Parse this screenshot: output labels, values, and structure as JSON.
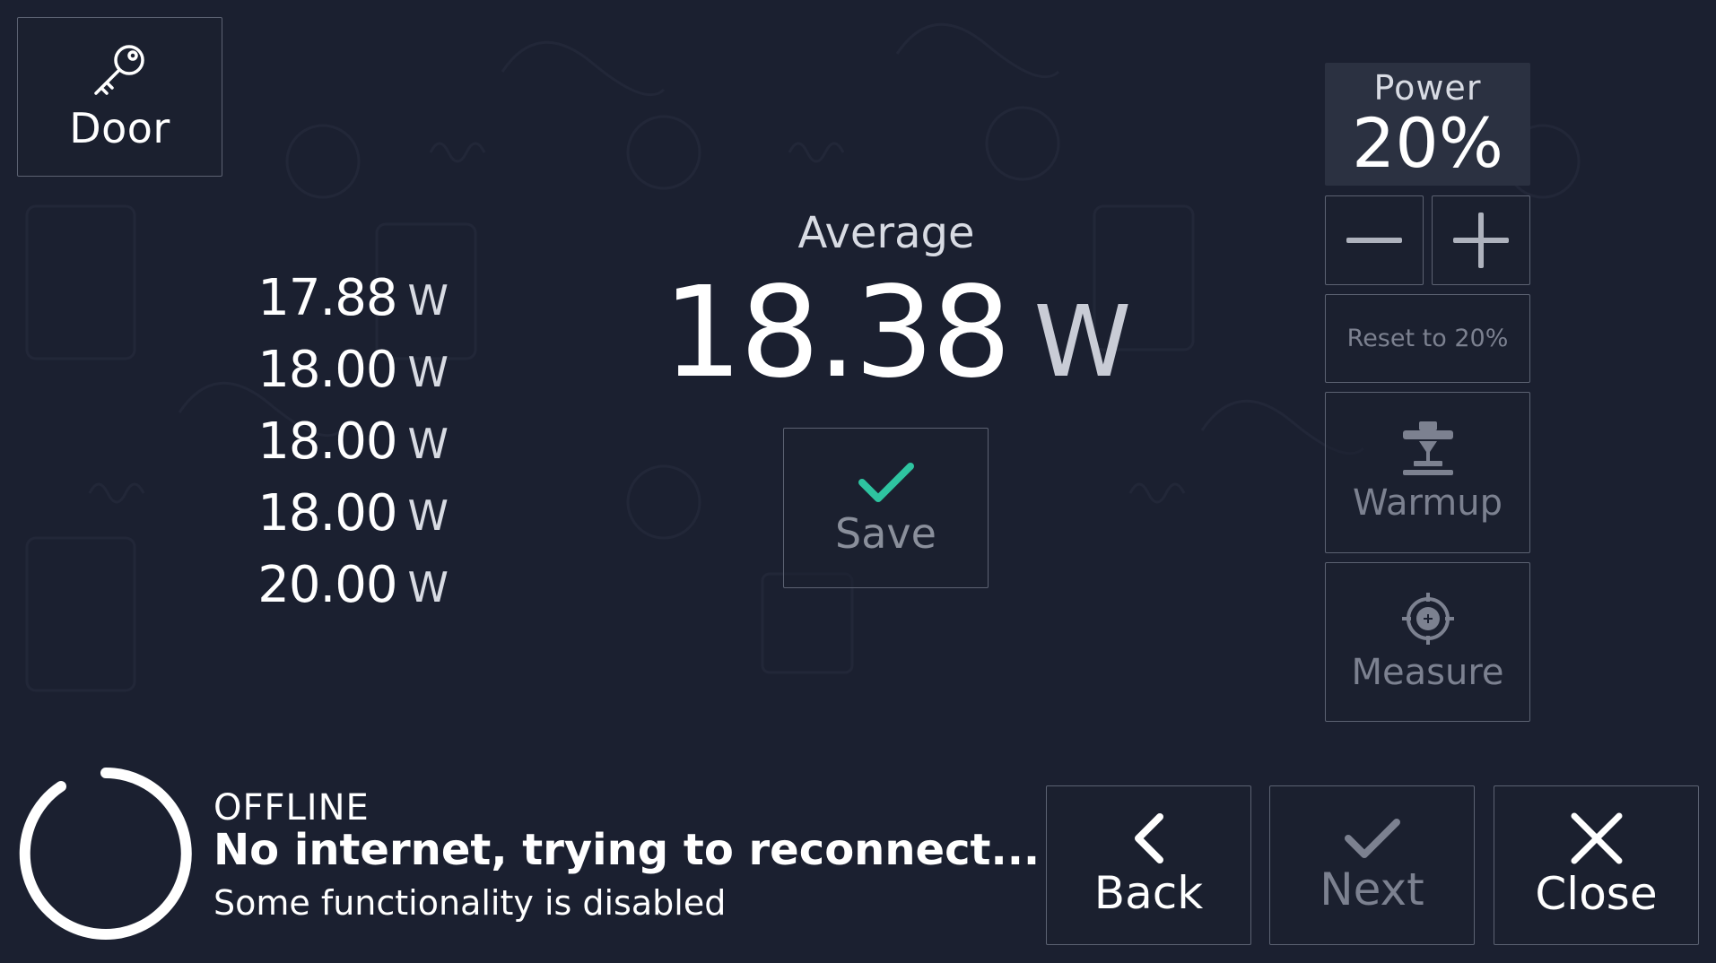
{
  "door": {
    "label": "Door",
    "icon": "key-icon"
  },
  "readings": [
    {
      "value": "17.88",
      "unit": "W"
    },
    {
      "value": "18.00",
      "unit": "W"
    },
    {
      "value": "18.00",
      "unit": "W"
    },
    {
      "value": "18.00",
      "unit": "W"
    },
    {
      "value": "20.00",
      "unit": "W"
    }
  ],
  "average": {
    "label": "Average",
    "value": "18.38",
    "unit": "W"
  },
  "save": {
    "label": "Save",
    "icon": "checkmark-icon",
    "icon_color": "#2ec4a0"
  },
  "power": {
    "label": "Power",
    "value": "20%"
  },
  "controls": {
    "decrease_icon": "minus-icon",
    "increase_icon": "plus-icon",
    "reset_label": "Reset to 20%",
    "warmup_label": "Warmup",
    "warmup_icon": "laser-head-icon",
    "measure_label": "Measure",
    "measure_icon": "crosshair-icon"
  },
  "status": {
    "title": "OFFLINE",
    "message": "No internet, trying to reconnect...",
    "detail": "Some functionality is disabled"
  },
  "nav": {
    "back_label": "Back",
    "next_label": "Next",
    "close_label": "Close"
  },
  "colors": {
    "background": "#1b2030",
    "accent": "#2ec4a0",
    "disabled_text": "#7c8190"
  }
}
